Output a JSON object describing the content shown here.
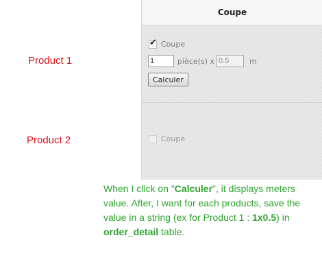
{
  "header": {
    "title": "Coupe"
  },
  "products": [
    {
      "label": "Product 1"
    },
    {
      "label": "Product 2"
    }
  ],
  "row1": {
    "checkbox_label": "Coupe",
    "checked": true,
    "quantity_value": "1",
    "pieces_label": "pièce(s) x",
    "length_value": "0.5",
    "unit_label": "m",
    "calc_button_label": "Calculer"
  },
  "row2": {
    "checkbox_label": "Coupe",
    "checked": false
  },
  "note": {
    "part1": "When I click on \"",
    "calculer": "Calculer",
    "part2": "\", it displays meters value. After, I want for each products, save the value in a string (ex for Product 1 : ",
    "example": "1x0.5",
    "part3": ") in ",
    "table": "order_detail",
    "part4": " table."
  },
  "colors": {
    "product_label": "#e0141e",
    "note_text": "#2fa32f"
  }
}
